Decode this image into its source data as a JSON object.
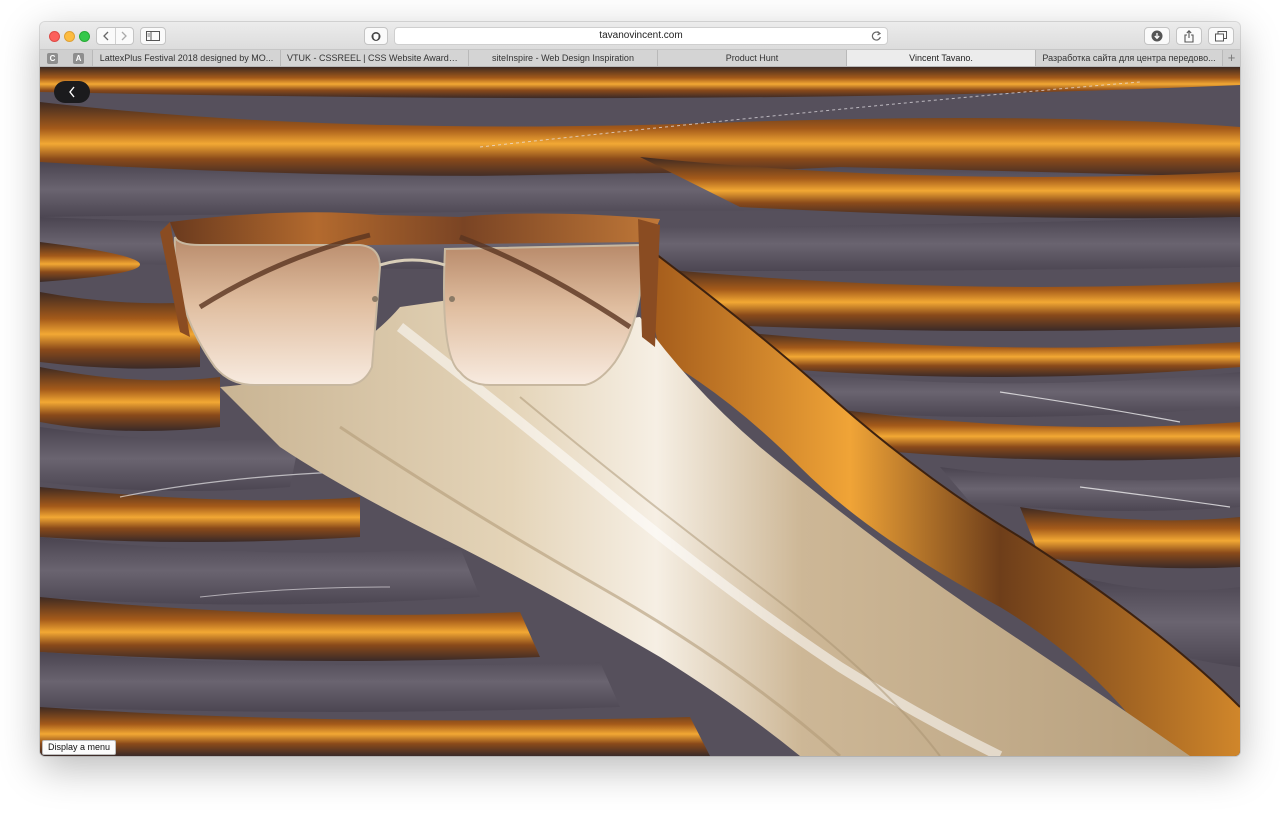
{
  "browser": {
    "url": "tavanovincent.com",
    "pinned_tabs": [
      "C",
      "A"
    ],
    "tabs": [
      {
        "title": "LattexPlus Festival 2018 designed by MO...",
        "active": false
      },
      {
        "title": "VTUK - CSSREEL | CSS Website Awards |...",
        "active": false
      },
      {
        "title": "siteInspire - Web Design Inspiration",
        "active": false
      },
      {
        "title": "Product Hunt",
        "active": false
      },
      {
        "title": "Vincent Tavano.",
        "active": true
      },
      {
        "title": "Разработка сайта для центра передово...",
        "active": false
      }
    ],
    "new_tab_label": "+"
  },
  "icons": {
    "back": "chevron-left-icon",
    "forward": "chevron-right-icon",
    "sidebar": "sidebar-icon",
    "shield": "shield-icon",
    "reload": "reload-icon",
    "download": "download-icon",
    "share": "share-icon",
    "tabs": "tabs-overview-icon",
    "page_back": "chevron-left-icon"
  },
  "page": {
    "tooltip": "Display a menu"
  },
  "colors": {
    "amber": "#d98a1c",
    "slate": "#5b5561",
    "cream": "#d9c6a7"
  }
}
